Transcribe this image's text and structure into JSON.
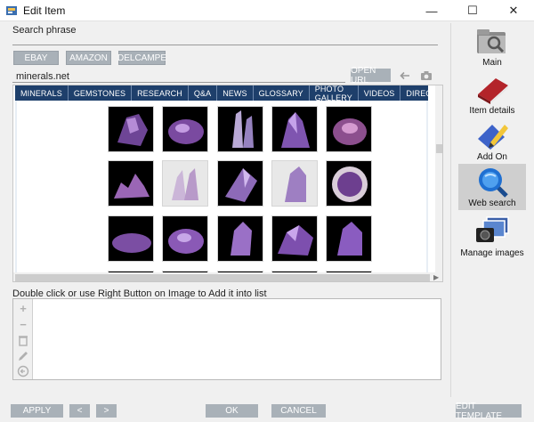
{
  "window": {
    "title": "Edit Item",
    "minimize": "—",
    "maximize": "☐",
    "close": "✕"
  },
  "search": {
    "label": "Search phrase"
  },
  "sources": {
    "ebay": "EBAY",
    "amazon": "AMAZON",
    "delcampe": "DELCAMPE"
  },
  "url": {
    "value": "minerals.net",
    "open_label": "OPEN URL"
  },
  "browser": {
    "nav": [
      "MINERALS",
      "GEMSTONES",
      "RESEARCH",
      "Q&A",
      "NEWS",
      "GLOSSARY",
      "PHOTO GALLERY",
      "VIDEOS",
      "DIRECTORY"
    ]
  },
  "hint": "Double click or use Right Button on Image to Add it into list",
  "list_tools": {
    "add": "+",
    "remove": "−"
  },
  "buttons": {
    "apply": "APPLY",
    "prev": "<",
    "next": ">",
    "ok": "OK",
    "cancel": "CANCEL",
    "edit_template": "EDIT TEMPLATE"
  },
  "right_panel": [
    {
      "label": "Main",
      "icon": "folder-magnifier-icon"
    },
    {
      "label": "Item details",
      "icon": "red-book-icon"
    },
    {
      "label": "Add On",
      "icon": "pencil-document-icon"
    },
    {
      "label": "Web search",
      "icon": "magnifier-globe-icon"
    },
    {
      "label": "Manage images",
      "icon": "camera-images-icon"
    }
  ],
  "colors": {
    "button": "#a9b1b8",
    "nav": "#1e3f6b",
    "selected": "#cfcfcf",
    "amethyst": "#7a4a9e"
  }
}
